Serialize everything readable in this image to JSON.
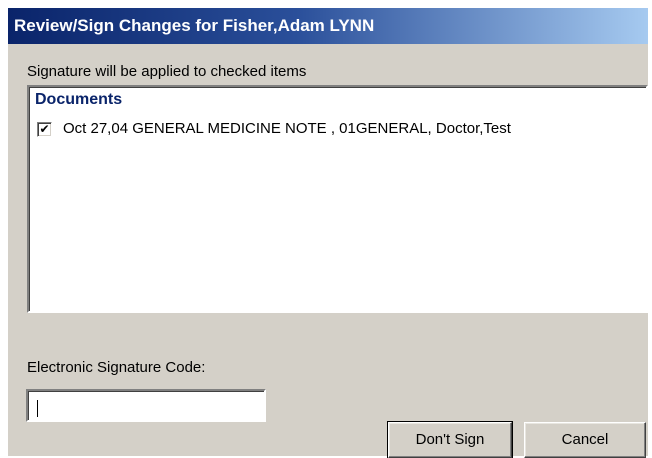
{
  "window": {
    "title": "Review/Sign Changes for Fisher,Adam LYNN"
  },
  "instructions": "Signature will be applied to checked items",
  "documents": {
    "header": "Documents",
    "items": [
      {
        "checked": true,
        "text": "Oct 27,04   GENERAL MEDICINE NOTE , 01GENERAL, Doctor,Test"
      }
    ]
  },
  "esignature": {
    "label": "Electronic Signature Code:",
    "value": ""
  },
  "buttons": {
    "dont_sign": "Don't Sign",
    "cancel": "Cancel"
  },
  "colors": {
    "title_gradient_start": "#0a246a",
    "title_gradient_end": "#a6caf0",
    "dialog_face": "#d4d0c8",
    "section_header": "#0a246a"
  },
  "icons": {
    "checkmark": "check-icon"
  }
}
